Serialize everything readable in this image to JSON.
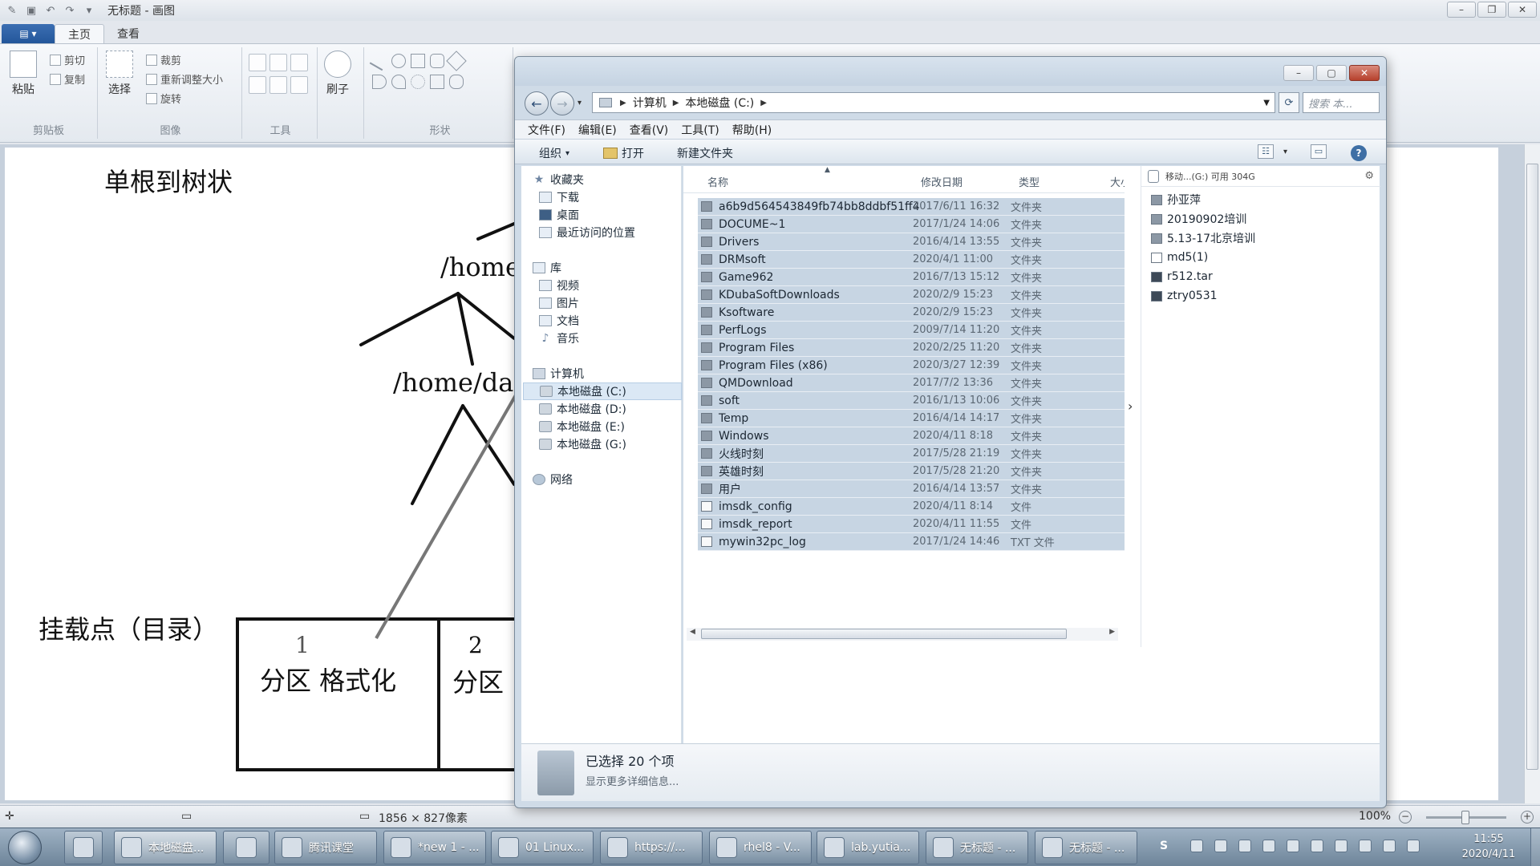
{
  "paint": {
    "title": "无标题 - 画图",
    "tabs": [
      "主页",
      "查看"
    ],
    "clipboard": {
      "paste": "粘贴",
      "cut": "剪切",
      "copy": "复制",
      "label": "剪贴板"
    },
    "image": {
      "select": "选择",
      "crop": "裁剪",
      "resize": "重新调整大小",
      "rotate": "旋转",
      "label": "图像"
    },
    "tools": {
      "label": "工具"
    },
    "brush": {
      "label": "刷子"
    },
    "shapes": {
      "label": "形状"
    },
    "canvas_text": {
      "title": "单根到树状",
      "home": "/home",
      "home_data": "/home/da",
      "mount": "挂载点（目录）",
      "p1_num": "1",
      "p1_text": "分区  格式化",
      "p2_num": "2",
      "p2_text": "分区"
    },
    "status": {
      "size": "1856 × 827像素",
      "zoom": "100%"
    }
  },
  "explorer": {
    "address": [
      "计算机",
      "本地磁盘 (C:)"
    ],
    "search_placeholder": "搜索 本...",
    "menu": [
      "文件(F)",
      "编辑(E)",
      "查看(V)",
      "工具(T)",
      "帮助(H)"
    ],
    "toolbar": {
      "organize": "组织",
      "open": "打开",
      "new_folder": "新建文件夹"
    },
    "nav": {
      "favorites": "收藏夹",
      "fav_items": [
        "下载",
        "桌面",
        "最近访问的位置"
      ],
      "libraries": "库",
      "lib_items": [
        "视频",
        "图片",
        "文档",
        "音乐"
      ],
      "computer": "计算机",
      "drives": [
        "本地磁盘 (C:)",
        "本地磁盘 (D:)",
        "本地磁盘 (E:)",
        "本地磁盘 (G:)"
      ],
      "network": "网络"
    },
    "columns": {
      "name": "名称",
      "date": "修改日期",
      "type": "类型",
      "size": "大小"
    },
    "files": [
      {
        "name": "a6b9d564543849fb74bb8ddbf51ff4",
        "date": "2017/6/11 16:32",
        "type": "文件夹",
        "kind": "folder"
      },
      {
        "name": "DOCUME~1",
        "date": "2017/1/24 14:06",
        "type": "文件夹",
        "kind": "folder"
      },
      {
        "name": "Drivers",
        "date": "2016/4/14 13:55",
        "type": "文件夹",
        "kind": "folder"
      },
      {
        "name": "DRMsoft",
        "date": "2020/4/1 11:00",
        "type": "文件夹",
        "kind": "folder"
      },
      {
        "name": "Game962",
        "date": "2016/7/13 15:12",
        "type": "文件夹",
        "kind": "folder"
      },
      {
        "name": "KDubaSoftDownloads",
        "date": "2020/2/9 15:23",
        "type": "文件夹",
        "kind": "folder"
      },
      {
        "name": "Ksoftware",
        "date": "2020/2/9 15:23",
        "type": "文件夹",
        "kind": "folder"
      },
      {
        "name": "PerfLogs",
        "date": "2009/7/14 11:20",
        "type": "文件夹",
        "kind": "folder"
      },
      {
        "name": "Program Files",
        "date": "2020/2/25 11:20",
        "type": "文件夹",
        "kind": "folder"
      },
      {
        "name": "Program Files (x86)",
        "date": "2020/3/27 12:39",
        "type": "文件夹",
        "kind": "folder"
      },
      {
        "name": "QMDownload",
        "date": "2017/7/2 13:36",
        "type": "文件夹",
        "kind": "folder"
      },
      {
        "name": "soft",
        "date": "2016/1/13 10:06",
        "type": "文件夹",
        "kind": "folder"
      },
      {
        "name": "Temp",
        "date": "2016/4/14 14:17",
        "type": "文件夹",
        "kind": "folder"
      },
      {
        "name": "Windows",
        "date": "2020/4/11 8:18",
        "type": "文件夹",
        "kind": "folder"
      },
      {
        "name": "火线时刻",
        "date": "2017/5/28 21:19",
        "type": "文件夹",
        "kind": "folder"
      },
      {
        "name": "英雄时刻",
        "date": "2017/5/28 21:20",
        "type": "文件夹",
        "kind": "folder"
      },
      {
        "name": "用户",
        "date": "2016/4/14 13:57",
        "type": "文件夹",
        "kind": "folder"
      },
      {
        "name": "imsdk_config",
        "date": "2020/4/11 8:14",
        "type": "文件",
        "kind": "file"
      },
      {
        "name": "imsdk_report",
        "date": "2020/4/11 11:55",
        "type": "文件",
        "kind": "file"
      },
      {
        "name": "mywin32pc_log",
        "date": "2017/1/24 14:46",
        "type": "TXT 文件",
        "kind": "file"
      }
    ],
    "preview": {
      "header": "移动...(G:) 可用 304G",
      "items": [
        {
          "name": "孙亚萍",
          "kind": "folder"
        },
        {
          "name": "20190902培训",
          "kind": "folder"
        },
        {
          "name": "5.13-17北京培训",
          "kind": "folder"
        },
        {
          "name": "md5(1)",
          "kind": "file"
        },
        {
          "name": "r512.tar",
          "kind": "archive"
        },
        {
          "name": "ztry0531",
          "kind": "archive"
        }
      ]
    },
    "details": {
      "count": "已选择 20 个项",
      "more": "显示更多详细信息..."
    }
  },
  "taskbar": {
    "items": [
      {
        "label": "本地磁盘...",
        "active": true
      },
      {
        "label": "",
        "active": false
      },
      {
        "label": "腾讯课堂",
        "active": false
      },
      {
        "label": "*new 1 - ...",
        "active": false
      },
      {
        "label": "01 Linux...",
        "active": false
      },
      {
        "label": "https://...",
        "active": false
      },
      {
        "label": "rhel8 - V...",
        "active": false
      },
      {
        "label": "lab.yutia...",
        "active": false
      },
      {
        "label": "无标题 - ...",
        "active": false
      },
      {
        "label": "无标题 - ...",
        "active": false
      }
    ],
    "time": "11:55",
    "date": "2020/4/11"
  }
}
